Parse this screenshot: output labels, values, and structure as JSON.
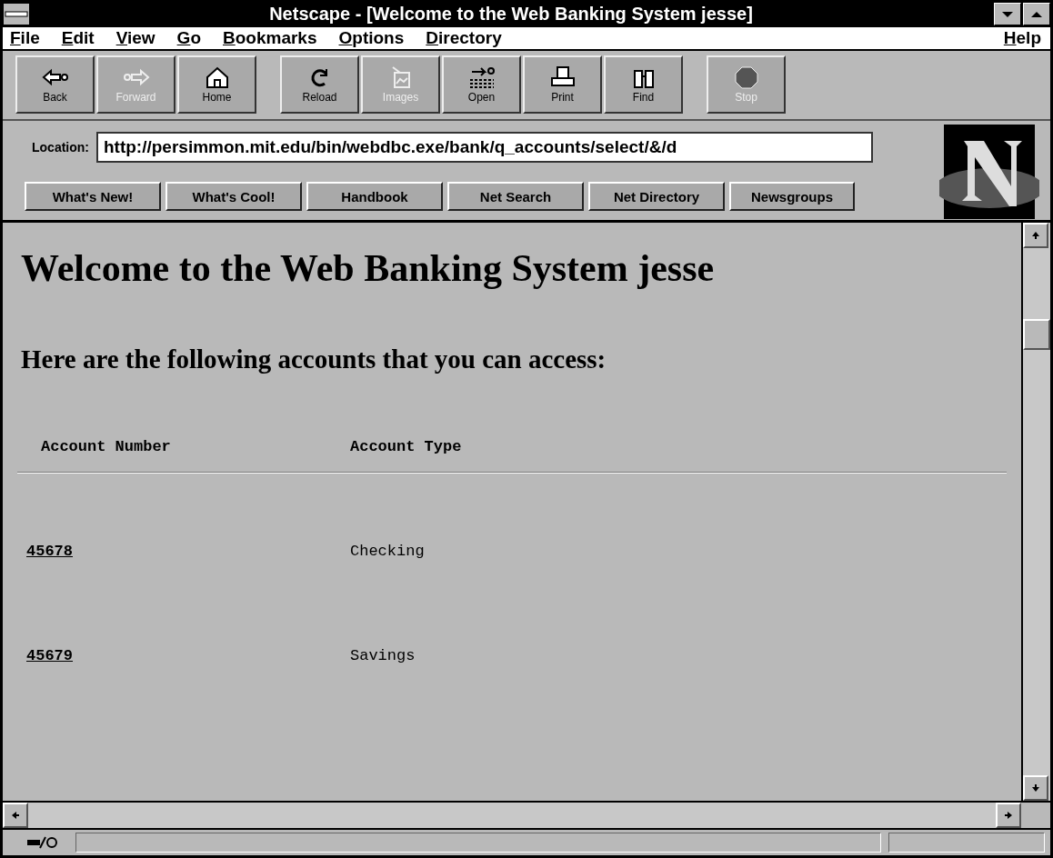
{
  "window": {
    "title": "Netscape - [Welcome to the Web Banking System jesse]"
  },
  "menu": [
    "File",
    "Edit",
    "View",
    "Go",
    "Bookmarks",
    "Options",
    "Directory",
    "Help"
  ],
  "toolbar": [
    {
      "label": "Back",
      "disabled": false
    },
    {
      "label": "Forward",
      "disabled": true
    },
    {
      "label": "Home",
      "disabled": false
    },
    {
      "label": "Reload",
      "disabled": false
    },
    {
      "label": "Images",
      "disabled": true
    },
    {
      "label": "Open",
      "disabled": false
    },
    {
      "label": "Print",
      "disabled": false
    },
    {
      "label": "Find",
      "disabled": false
    },
    {
      "label": "Stop",
      "disabled": true
    }
  ],
  "location": {
    "label": "Location:",
    "value": "http://persimmon.mit.edu/bin/webdbc.exe/bank/q_accounts/select/&/d"
  },
  "directory_buttons": [
    "What's New!",
    "What's Cool!",
    "Handbook",
    "Net Search",
    "Net Directory",
    "Newsgroups"
  ],
  "page": {
    "heading": "Welcome to the Web Banking System jesse",
    "subheading": "Here are the following accounts that you can access:",
    "table": {
      "columns": [
        "Account Number",
        "Account Type"
      ],
      "rows": [
        {
          "number": "45678",
          "type": "Checking"
        },
        {
          "number": "45679",
          "type": "Savings"
        }
      ]
    }
  }
}
